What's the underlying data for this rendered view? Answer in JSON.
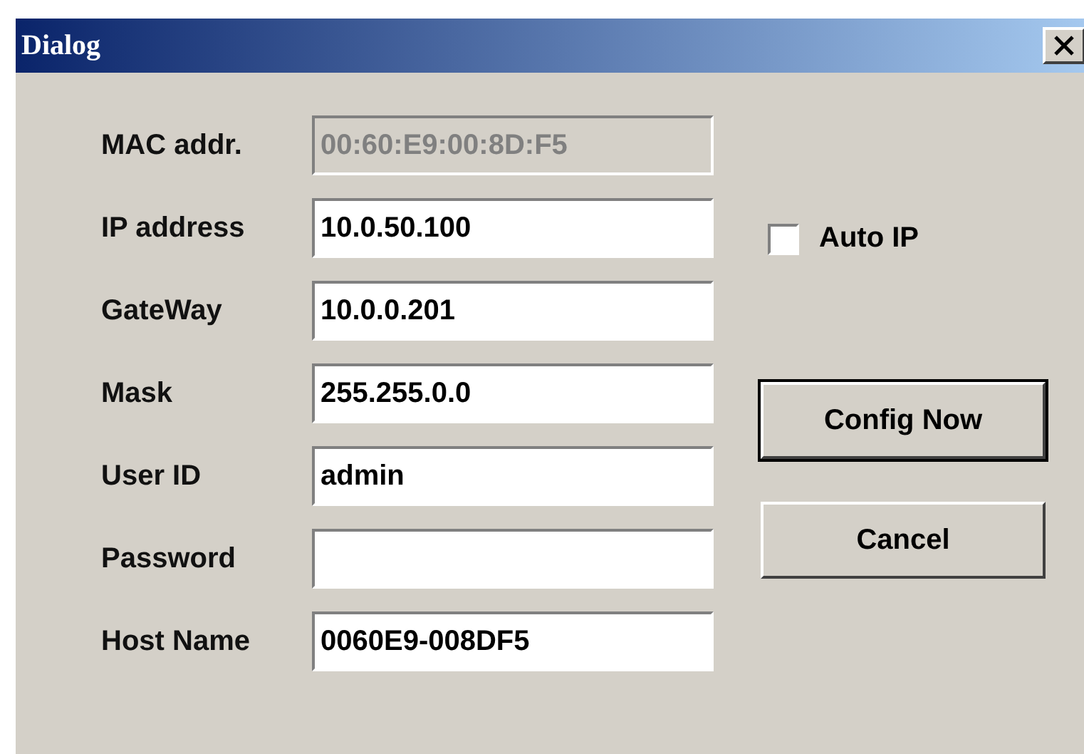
{
  "window": {
    "title": "Dialog"
  },
  "fields": [
    {
      "label": "MAC addr.",
      "value": "00:60:E9:00:8D:F5",
      "disabled": true
    },
    {
      "label": "IP address",
      "value": "10.0.50.100",
      "disabled": false
    },
    {
      "label": "GateWay",
      "value": "10.0.0.201",
      "disabled": false
    },
    {
      "label": "Mask",
      "value": "255.255.0.0",
      "disabled": false
    },
    {
      "label": "User ID",
      "value": "admin",
      "disabled": false
    },
    {
      "label": "Password",
      "disabled": false
    },
    {
      "label": "Host Name",
      "value": "0060E9-008DF5",
      "disabled": false
    }
  ],
  "auto_ip": {
    "label": "Auto IP",
    "checked": false
  },
  "buttons": [
    {
      "label": "Config Now",
      "default": true
    },
    {
      "label": "Cancel",
      "default": false
    }
  ]
}
